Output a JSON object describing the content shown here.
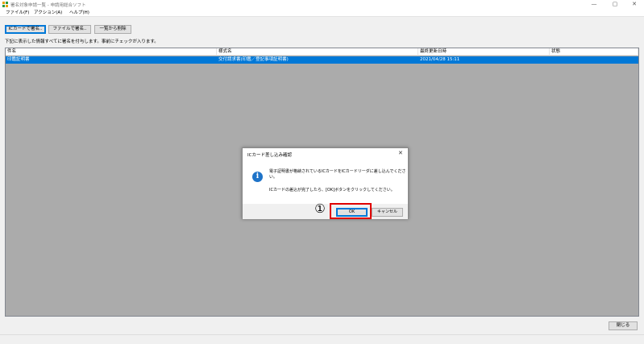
{
  "window": {
    "title": "署名対象申請一覧 - 申請用総合ソフト",
    "minimize_glyph": "—",
    "maximize_glyph": "▢",
    "close_glyph": "✕"
  },
  "menu": {
    "items": [
      "ファイル(F)",
      "アクション(A)",
      "ヘルプ(H)"
    ]
  },
  "toolbar": {
    "ic_sign_label": "ICカードで署名..",
    "file_sign_label": "ファイルで署名..",
    "remove_label": "一覧から削除"
  },
  "instruction": "下記に表示した情報すべてに署名を付与します。事前にチェックが入ります。",
  "list": {
    "columns": [
      "件名",
      "様式名",
      "最終更新日時",
      "状態"
    ],
    "rows": [
      {
        "subject": "印鑑証明書",
        "form": "交付請求書(印鑑／登記事項証明書)",
        "updated": "2021/04/28 15:11",
        "status": ""
      }
    ]
  },
  "dialog": {
    "title": "ICカード差し込み確認",
    "close_glyph": "✕",
    "icon": "info-icon",
    "icon_glyph": "i",
    "message_line1": "電子証明書が格納されているICカードをICカードリーダに差し込んでくださ",
    "message_line2": "い。",
    "message_line3": "ICカードの差込が完了したら、[OK]ボタンをクリックしてください。",
    "ok_label": "OK",
    "cancel_label": "キャンセル"
  },
  "annotation": {
    "step_number": "①",
    "color": "#e00000"
  },
  "footer": {
    "close_label": "閉じる"
  },
  "colors": {
    "selection": "#0078d7",
    "list_background": "#ababab",
    "info_icon": "#1e73c8"
  }
}
